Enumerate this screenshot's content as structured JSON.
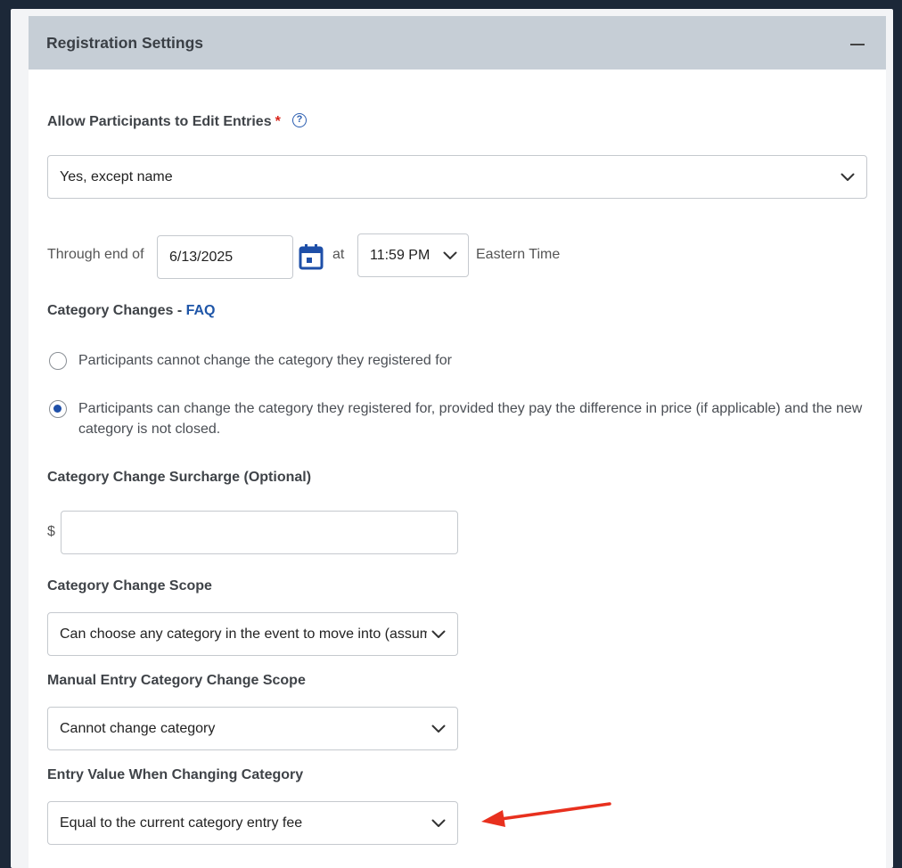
{
  "panel": {
    "title": "Registration Settings"
  },
  "allow_edit": {
    "label": "Allow Participants to Edit Entries",
    "required_mark": "*",
    "help_symbol": "?",
    "selected": "Yes, except name"
  },
  "through": {
    "prefix": "Through end of",
    "date": "6/13/2025",
    "at_label": "at",
    "time": "11:59 PM",
    "timezone": "Eastern Time"
  },
  "category_changes": {
    "label": "Category Changes -",
    "faq_link": "FAQ",
    "options": [
      {
        "text": "Participants cannot change the category they registered for",
        "selected": false
      },
      {
        "text": "Participants can change the category they registered for, provided they pay the difference in price (if applicable) and the new category is not closed.",
        "selected": true
      }
    ]
  },
  "surcharge": {
    "label": "Category Change Surcharge (Optional)",
    "currency": "$",
    "value": ""
  },
  "scope": {
    "label": "Category Change Scope",
    "selected": "Can choose any category in the event to move into (assuming"
  },
  "manual_scope": {
    "label": "Manual Entry Category Change Scope",
    "selected": "Cannot change category"
  },
  "entry_value": {
    "label": "Entry Value When Changing Category",
    "selected": "Equal to the current category entry fee"
  },
  "colors": {
    "header_bg": "#c6ced6",
    "accent_blue": "#1f56a8",
    "required_red": "#d9261c",
    "annotation_arrow": "#e8301e"
  }
}
